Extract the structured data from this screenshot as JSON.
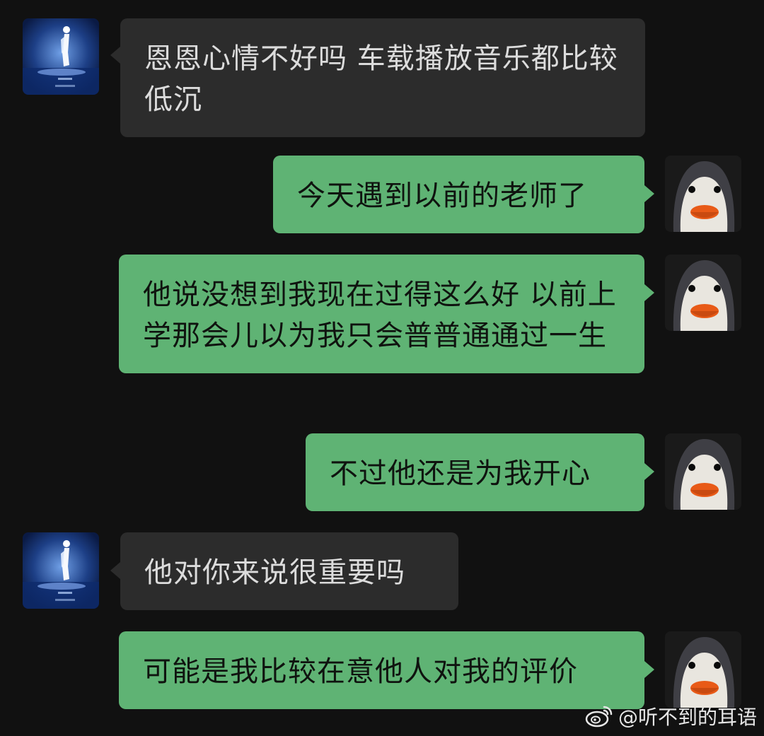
{
  "messages": [
    {
      "side": "in",
      "text": "恩恩心情不好吗 车载播放音乐都比较低沉"
    },
    {
      "side": "out",
      "text": "今天遇到以前的老师了"
    },
    {
      "side": "out",
      "text": "他说没想到我现在过得这么好 以前上学那会儿以为我只会普普通通过一生"
    },
    {
      "side": "out",
      "text": "不过他还是为我开心"
    },
    {
      "side": "in",
      "text": "他对你来说很重要吗"
    },
    {
      "side": "out",
      "text": "可能是我比较在意他人对我的评价"
    }
  ],
  "watermark": {
    "icon": "weibo-icon",
    "text": "@听不到的耳语"
  },
  "colors": {
    "background": "#111111",
    "incoming_bubble": "#2c2c2c",
    "outgoing_bubble": "#5fb374"
  }
}
